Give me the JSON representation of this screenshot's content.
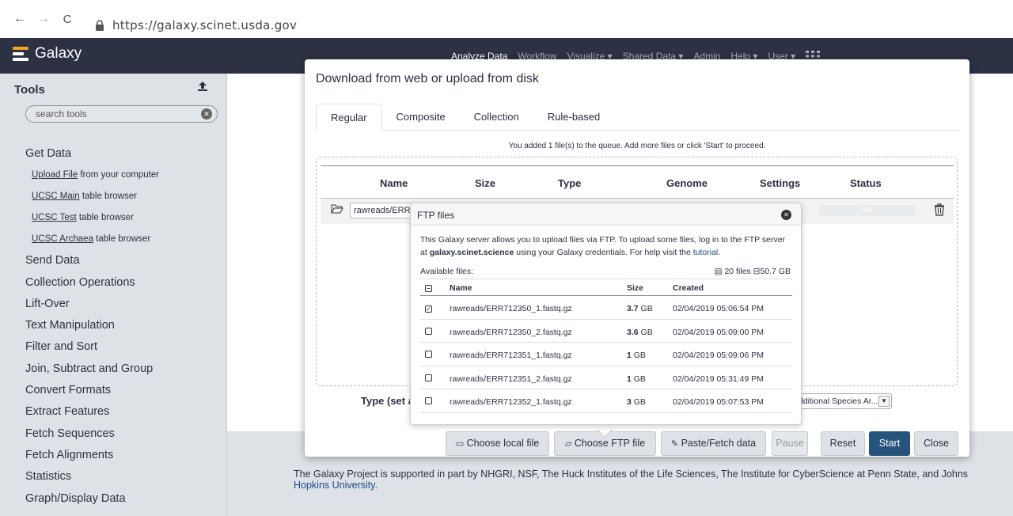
{
  "browser": {
    "url": "https://galaxy.scinet.usda.gov",
    "back_icon": "←",
    "forward_icon": "→",
    "reload_icon": "C"
  },
  "masthead": {
    "brand": "Galaxy",
    "nav": [
      "Analyze Data",
      "Workflow",
      "Visualize ▾",
      "Shared Data ▾",
      "Admin",
      "Help ▾",
      "User ▾"
    ]
  },
  "tool_panel": {
    "title": "Tools",
    "search_placeholder": "search tools",
    "sections": [
      {
        "name": "Get Data",
        "tools": [
          {
            "link": "Upload File",
            "rest": " from your computer"
          },
          {
            "link": "UCSC Main",
            "rest": " table browser"
          },
          {
            "link": "UCSC Test",
            "rest": " table browser"
          },
          {
            "link": "UCSC Archaea",
            "rest": " table browser"
          }
        ]
      },
      {
        "name": "Send Data"
      },
      {
        "name": "Collection Operations"
      },
      {
        "name": "Lift-Over"
      },
      {
        "name": "Text Manipulation"
      },
      {
        "name": "Filter and Sort"
      },
      {
        "name": "Join, Subtract and Group"
      },
      {
        "name": "Convert Formats"
      },
      {
        "name": "Extract Features"
      },
      {
        "name": "Fetch Sequences"
      },
      {
        "name": "Fetch Alignments"
      },
      {
        "name": "Statistics"
      },
      {
        "name": "Graph/Display Data"
      }
    ]
  },
  "center": {
    "footer_text": "The Galaxy Project is supported in part by NHGRI, NSF, The Huck Institutes of the Life Sciences, The Institute for CyberScience at Penn State, and Johns",
    "footer_link": "Hopkins University."
  },
  "modal": {
    "title": "Download from web or upload from disk",
    "tabs": [
      "Regular",
      "Composite",
      "Collection",
      "Rule-based"
    ],
    "active_tab": "Regular",
    "queue_message": "You added 1 file(s) to the queue. Add more files or click 'Start' to proceed.",
    "columns": [
      "Name",
      "Size",
      "Type",
      "Genome",
      "Settings",
      "Status"
    ],
    "row": {
      "name": "rawreads/ERR712350_1.fastq.gz",
      "progress": "0%"
    },
    "type_label": "Type (set all):",
    "genome_value": "Additional Species Ar...",
    "buttons": {
      "local": "Choose local file",
      "ftp": "Choose FTP file",
      "paste": "Paste/Fetch data",
      "pause": "Pause",
      "reset": "Reset",
      "start": "Start",
      "close": "Close"
    }
  },
  "ftp": {
    "title": "FTP files",
    "info_pre": "This Galaxy server allows you to upload files via FTP. To upload some files, log in to the FTP server at ",
    "server": "galaxy.scinet.science",
    "info_mid": " using your Galaxy credentials. For help visit the ",
    "tutorial": "tutorial",
    "info_post": ".",
    "available_label": "Available files:",
    "count_label": "20 files",
    "total_size": "50.7 GB",
    "headers": {
      "name": "Name",
      "size": "Size",
      "created": "Created"
    },
    "files": [
      {
        "checked": true,
        "name": "rawreads/ERR712350_1.fastq.gz",
        "size_num": "3.7",
        "size_unit": " GB",
        "created": "02/04/2019 05:06:54 PM"
      },
      {
        "checked": false,
        "name": "rawreads/ERR712350_2.fastq.gz",
        "size_num": "3.6",
        "size_unit": " GB",
        "created": "02/04/2019 05:09:00 PM"
      },
      {
        "checked": false,
        "name": "rawreads/ERR712351_1.fastq.gz",
        "size_num": "1",
        "size_unit": " GB",
        "created": "02/04/2019 05:09:06 PM"
      },
      {
        "checked": false,
        "name": "rawreads/ERR712351_2.fastq.gz",
        "size_num": "1",
        "size_unit": " GB",
        "created": "02/04/2019 05:31:49 PM"
      },
      {
        "checked": false,
        "name": "rawreads/ERR712352_1.fastq.gz",
        "size_num": "3",
        "size_unit": " GB",
        "created": "02/04/2019 05:07:53 PM"
      }
    ]
  },
  "colors": {
    "masthead": "#2c3143",
    "panel": "#dee2e6",
    "primary": "#25537b",
    "link": "#1c4a8c"
  }
}
